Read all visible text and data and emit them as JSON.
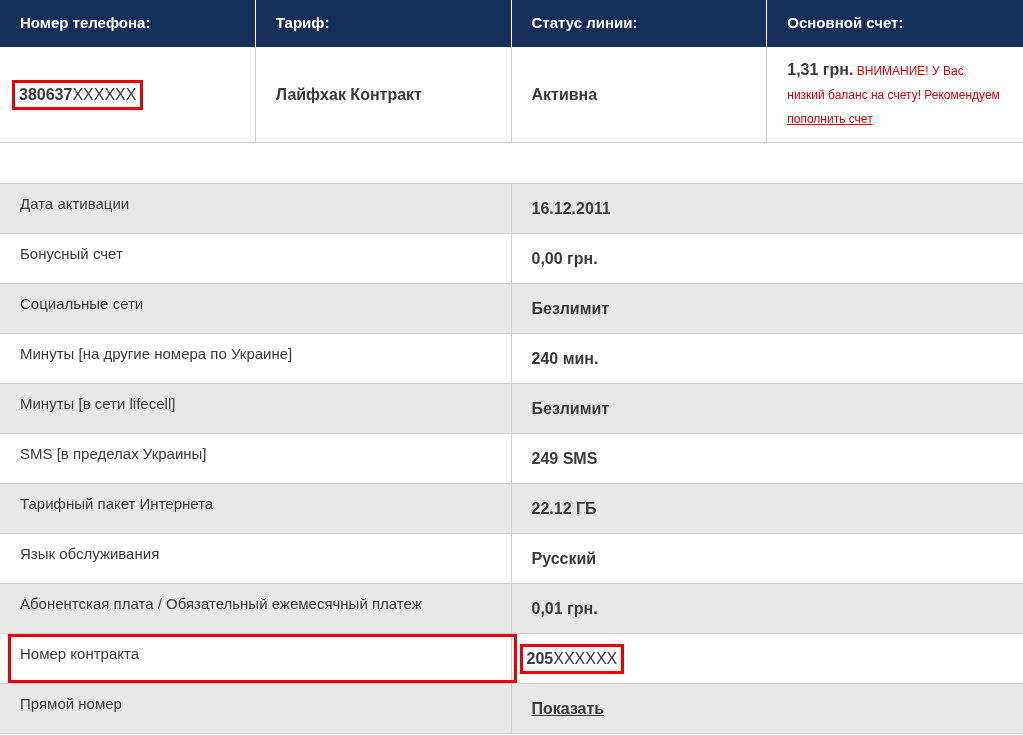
{
  "summary": {
    "columns": [
      {
        "heading": "Номер телефона:"
      },
      {
        "heading": "Тариф:"
      },
      {
        "heading": "Статус линии:"
      },
      {
        "heading": "Основной счет:"
      }
    ],
    "phone": {
      "value": "**380637**XXXXXX",
      "highlighted": true
    },
    "tariff": "Лайфхак Контракт",
    "status": "Активна",
    "balance": {
      "amount": "1,31 грн.",
      "warning": "ВНИМАНИЕ! У Вас низкий баланс на счету! Рекомендуем",
      "link": "пополнить счет"
    }
  },
  "details": [
    {
      "label": "Дата активации",
      "value": "16.12.2011",
      "kind": "text",
      "highlighted": false
    },
    {
      "label": "Бонусный счет",
      "value": "0,00 грн.",
      "kind": "text",
      "highlighted": false
    },
    {
      "label": "Социальные сети",
      "value": "Безлимит",
      "kind": "text",
      "highlighted": false
    },
    {
      "label": "Минуты [на другие номера по Украине]",
      "value": "240 мин.",
      "kind": "text",
      "highlighted": false
    },
    {
      "label": "Минуты [в сети lifecell]",
      "value": "Безлимит",
      "kind": "text",
      "highlighted": false
    },
    {
      "label": "SMS [в пределах Украины]",
      "value": "249 SMS",
      "kind": "text",
      "highlighted": false
    },
    {
      "label": "Тарифный пакет Интернета",
      "value": "22.12 ГБ",
      "kind": "text",
      "highlighted": false
    },
    {
      "label": "Язык обслуживания",
      "value": "Русский",
      "kind": "text",
      "highlighted": false
    },
    {
      "label": "Абонентская плата / Обязательный ежемесячный платеж",
      "value": "0,01 грн.",
      "kind": "text",
      "highlighted": false
    },
    {
      "label": "Номер контракта",
      "value": "**205**XXXXXX",
      "kind": "masked",
      "highlighted": true
    },
    {
      "label": "Прямой номер",
      "value": "Показать",
      "kind": "link",
      "highlighted": false
    }
  ]
}
